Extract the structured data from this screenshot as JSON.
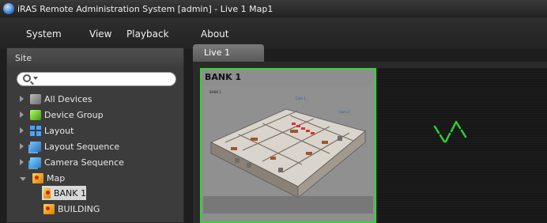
{
  "window": {
    "title": "iRAS Remote Administration System [admin] - Live 1  Map1"
  },
  "menu": {
    "items": [
      "System",
      "View",
      "Playback",
      "About"
    ]
  },
  "sidebar": {
    "header": "Site",
    "tree": [
      {
        "label": "All Devices",
        "icon": "devices-icon"
      },
      {
        "label": "Device Group",
        "icon": "device-group-icon"
      },
      {
        "label": "Layout",
        "icon": "layout-icon"
      },
      {
        "label": "Layout Sequence",
        "icon": "layout-sequence-icon"
      },
      {
        "label": "Camera Sequence",
        "icon": "camera-sequence-icon"
      },
      {
        "label": "Map",
        "icon": "map-icon",
        "expanded": true,
        "children": [
          {
            "label": "BANK 1",
            "icon": "map-icon",
            "selected": true
          },
          {
            "label": "BUILDING",
            "icon": "map-icon"
          }
        ]
      }
    ]
  },
  "tabs": [
    {
      "label": "Live  1",
      "active": true
    }
  ],
  "panels": {
    "bank": {
      "title": "BANK 1",
      "map_text_small": "BANK 1",
      "map_labels": [
        "Cam 1",
        "Cam 2"
      ]
    },
    "video": {
      "status_icon": "loading-icon"
    }
  },
  "colors": {
    "selected_border": "#34d634",
    "loading": "#2ed12e"
  }
}
